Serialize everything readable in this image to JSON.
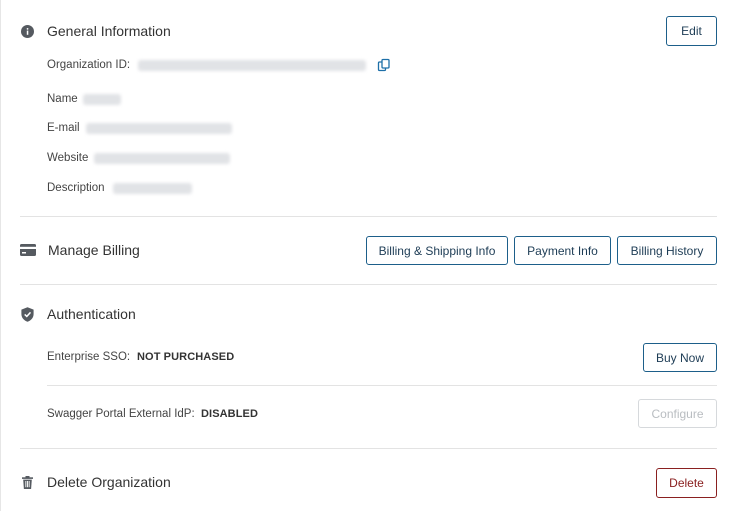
{
  "general": {
    "title": "General Information",
    "edit_label": "Edit",
    "org_id_label": "Organization ID:",
    "name_label": "Name",
    "email_label": "E-mail",
    "website_label": "Website",
    "description_label": "Description"
  },
  "billing": {
    "title": "Manage Billing",
    "shipping_label": "Billing & Shipping Info",
    "payment_label": "Payment Info",
    "history_label": "Billing History"
  },
  "auth": {
    "title": "Authentication",
    "sso_label": "Enterprise SSO:",
    "sso_status": "NOT PURCHASED",
    "buy_label": "Buy Now",
    "idp_label": "Swagger Portal External IdP:",
    "idp_status": "DISABLED",
    "configure_label": "Configure"
  },
  "delete": {
    "title": "Delete Organization",
    "delete_label": "Delete"
  },
  "colors": {
    "primary": "#1d5f8a",
    "danger": "#8a2020",
    "icon": "#555a60"
  }
}
